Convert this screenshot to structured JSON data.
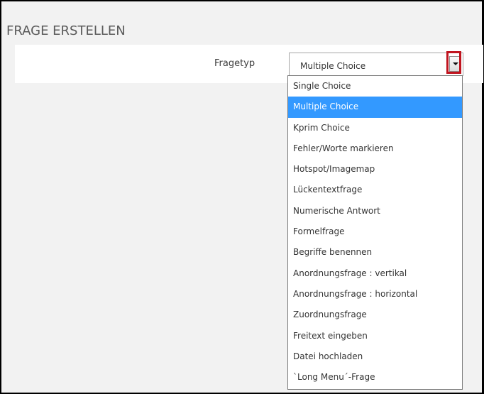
{
  "page": {
    "title": "FRAGE ERSTELLEN"
  },
  "form": {
    "question_type_label": "Fragetyp",
    "select": {
      "value": "Multiple Choice",
      "arrow_icon": "chevron-down-icon"
    }
  },
  "dropdown": {
    "selected_index": 1,
    "options": [
      "Single Choice",
      "Multiple Choice",
      "Kprim Choice",
      "Fehler/Worte markieren",
      "Hotspot/Imagemap",
      "Lückentextfrage",
      "Numerische Antwort",
      "Formelfrage",
      "Begriffe benennen",
      "Anordnungsfrage : vertikal",
      "Anordnungsfrage : horizontal",
      "Zuordnungsfrage",
      "Freitext eingeben",
      "Datei hochladen",
      "`Long Menu´-Frage"
    ]
  },
  "colors": {
    "page_background": "#f2f2f2",
    "selected_option": "#3399ff",
    "highlight_box": "#c0141f"
  }
}
